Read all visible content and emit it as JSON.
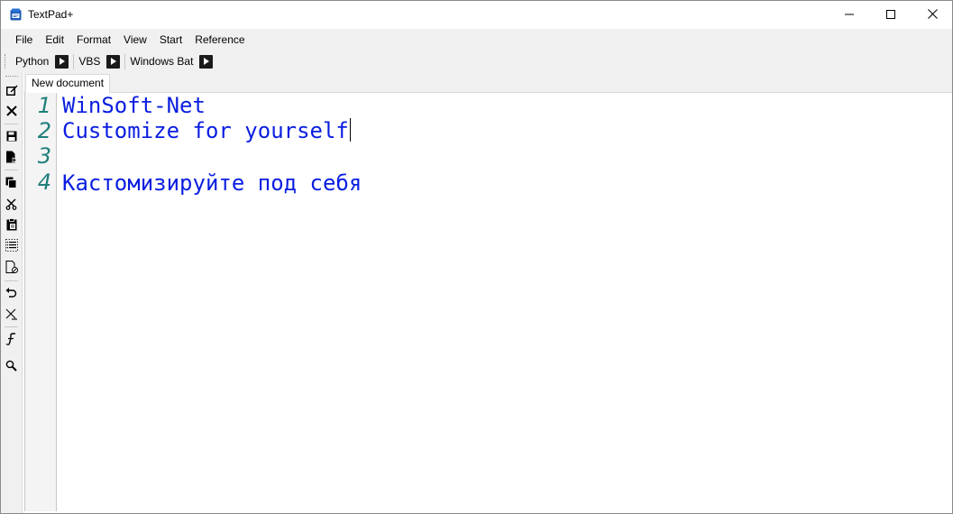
{
  "window": {
    "title": "TextPad+",
    "icon": "textpad-app-icon",
    "controls": [
      "minimize-icon",
      "maximize-icon",
      "close-icon"
    ]
  },
  "menu": [
    "File",
    "Edit",
    "Format",
    "View",
    "Start",
    "Reference"
  ],
  "run_toolbar": [
    {
      "label": "Python",
      "icon": "play-icon"
    },
    {
      "label": "VBS",
      "icon": "play-icon"
    },
    {
      "label": "Windows Bat",
      "icon": "play-icon"
    }
  ],
  "side_toolbar": {
    "icons": [
      "new-document-icon",
      "close-document-icon",
      "save-icon",
      "save-as-icon",
      "copy-icon",
      "cut-icon",
      "paste-icon",
      "select-all-icon",
      "document-settings-icon",
      "undo-icon",
      "delete-icon",
      "font-icon",
      "search-icon"
    ]
  },
  "tabs": [
    {
      "label": "New document",
      "active": true
    }
  ],
  "editor": {
    "lines": [
      {
        "number": "1",
        "text": "WinSoft-Net"
      },
      {
        "number": "2",
        "text": "Customize for yourself"
      },
      {
        "number": "3",
        "text": ""
      },
      {
        "number": "4",
        "text": "Кастомизируйте под себя"
      }
    ],
    "cursor_line": 2
  },
  "colors": {
    "text": "#0a1ee0",
    "line_numbers": "#1f7f7a",
    "toolbar_bg": "#f0f0f0"
  }
}
